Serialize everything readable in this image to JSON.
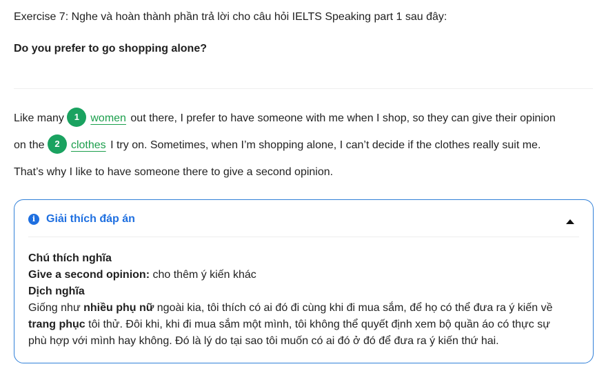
{
  "exercise": {
    "title": "Exercise 7: Nghe và hoàn thành phần trả lời cho câu hỏi IELTS Speaking part 1 sau đây:",
    "question": "Do you prefer to go shopping alone?"
  },
  "passage": {
    "l1_before": "Like many ",
    "blank1_num": "1",
    "blank1_answer": "women",
    "l1_after": " out there, I prefer to have someone with me when I shop, so they can give their opinion",
    "l2_before": "on the ",
    "blank2_num": "2",
    "blank2_answer": "clothes",
    "l2_after": " I try on. Sometimes, when I’m shopping alone, I can’t decide if the clothes really suit me.",
    "l3": "That’s why I like to have someone there to give a second opinion."
  },
  "explanation": {
    "header": "Giải thích đáp án",
    "icon": "info-icon",
    "vocab_heading": "Chú thích nghĩa",
    "term": "Give a second opinion:",
    "term_meaning": " cho thêm ý kiến khác",
    "translation_heading": "Dịch nghĩa",
    "t_part1": "Giống như ",
    "t_bold1": "nhiều phụ nữ",
    "t_part2": " ngoài kia, tôi thích có ai đó đi cùng khi đi mua sắm, để họ có thể đưa ra ý kiến về",
    "t_bold2": "trang phục",
    "t_part3": " tôi thử. Đôi khi, khi đi mua sắm một mình, tôi không thể quyết định xem bộ quần áo có thực sự",
    "t_part4": "phù hợp với mình hay không. Đó là lý do tại sao tôi muốn có ai đó ở đó để đưa ra ý kiến thứ hai."
  },
  "colors": {
    "badge": "#1aa260",
    "answer": "#1a9e4b",
    "panel_border": "#2f7fd8",
    "panel_title": "#1e6fe0"
  }
}
